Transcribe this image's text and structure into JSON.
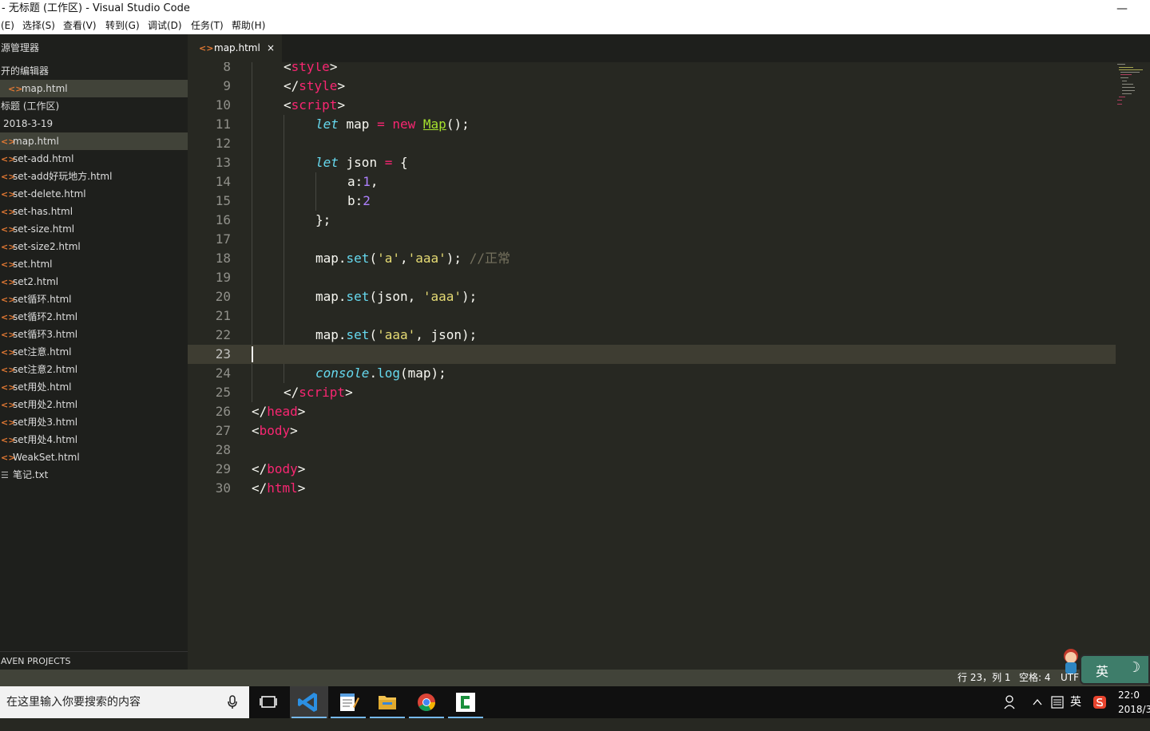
{
  "window": {
    "title": "- 无标题 (工作区) - Visual Studio Code",
    "minimize": "—"
  },
  "menu": [
    "(E)",
    "选择(S)",
    "查看(V)",
    "转到(G)",
    "调试(D)",
    "任务(T)",
    "帮助(H)"
  ],
  "sidebar": {
    "header": "源管理器",
    "open_editors_label": "开的编辑器",
    "open_editor_file": "map.html",
    "workspace_label": "标题 (工作区)",
    "folder_label": "2018-3-19",
    "files": [
      {
        "name": "map.html",
        "type": "html",
        "selected": true
      },
      {
        "name": "set-add.html",
        "type": "html"
      },
      {
        "name": "set-add好玩地方.html",
        "type": "html"
      },
      {
        "name": "set-delete.html",
        "type": "html"
      },
      {
        "name": "set-has.html",
        "type": "html"
      },
      {
        "name": "set-size.html",
        "type": "html"
      },
      {
        "name": "set-size2.html",
        "type": "html"
      },
      {
        "name": "set.html",
        "type": "html"
      },
      {
        "name": "set2.html",
        "type": "html"
      },
      {
        "name": "set循环.html",
        "type": "html"
      },
      {
        "name": "set循环2.html",
        "type": "html"
      },
      {
        "name": "set循环3.html",
        "type": "html"
      },
      {
        "name": "set注意.html",
        "type": "html"
      },
      {
        "name": "set注意2.html",
        "type": "html"
      },
      {
        "name": "set用处.html",
        "type": "html"
      },
      {
        "name": "set用处2.html",
        "type": "html"
      },
      {
        "name": "set用处3.html",
        "type": "html"
      },
      {
        "name": "set用处4.html",
        "type": "html"
      },
      {
        "name": "WeakSet.html",
        "type": "html"
      },
      {
        "name": "笔记.txt",
        "type": "txt"
      }
    ],
    "maven_label": "AVEN PROJECTS"
  },
  "tab": {
    "label": "map.html",
    "close": "×"
  },
  "editor": {
    "current_line": 23,
    "lines": [
      {
        "n": "8",
        "indent": 1,
        "tokens": [
          [
            "p",
            "<"
          ],
          [
            "tag",
            "style"
          ],
          [
            "p",
            ">"
          ]
        ]
      },
      {
        "n": "9",
        "indent": 1,
        "tokens": [
          [
            "p",
            "</"
          ],
          [
            "tag",
            "style"
          ],
          [
            "p",
            ">"
          ]
        ]
      },
      {
        "n": "10",
        "indent": 1,
        "tokens": [
          [
            "p",
            "<"
          ],
          [
            "tag",
            "script"
          ],
          [
            "p",
            ">"
          ]
        ]
      },
      {
        "n": "11",
        "indent": 2,
        "tokens": [
          [
            "st",
            "let"
          ],
          [
            "p",
            " map "
          ],
          [
            "kw",
            "="
          ],
          [
            "p",
            " "
          ],
          [
            "kw",
            "new"
          ],
          [
            "p",
            " "
          ],
          [
            "fn",
            "Map"
          ],
          [
            "p",
            "();"
          ]
        ]
      },
      {
        "n": "12",
        "indent": 2,
        "tokens": []
      },
      {
        "n": "13",
        "indent": 2,
        "tokens": [
          [
            "st",
            "let"
          ],
          [
            "p",
            " json "
          ],
          [
            "kw",
            "="
          ],
          [
            "p",
            " {"
          ]
        ]
      },
      {
        "n": "14",
        "indent": 3,
        "tokens": [
          [
            "p",
            "a:"
          ],
          [
            "num",
            "1"
          ],
          [
            "p",
            ","
          ]
        ]
      },
      {
        "n": "15",
        "indent": 3,
        "tokens": [
          [
            "p",
            "b:"
          ],
          [
            "num",
            "2"
          ]
        ]
      },
      {
        "n": "16",
        "indent": 2,
        "tokens": [
          [
            "p",
            "};"
          ]
        ]
      },
      {
        "n": "17",
        "indent": 2,
        "tokens": []
      },
      {
        "n": "18",
        "indent": 2,
        "tokens": [
          [
            "p",
            "map."
          ],
          [
            "fc",
            "set"
          ],
          [
            "p",
            "("
          ],
          [
            "str",
            "'a'"
          ],
          [
            "p",
            ","
          ],
          [
            "str",
            "'aaa'"
          ],
          [
            "p",
            "); "
          ],
          [
            "cm",
            "//正常"
          ]
        ]
      },
      {
        "n": "19",
        "indent": 2,
        "tokens": []
      },
      {
        "n": "20",
        "indent": 2,
        "tokens": [
          [
            "p",
            "map."
          ],
          [
            "fc",
            "set"
          ],
          [
            "p",
            "(json, "
          ],
          [
            "str",
            "'aaa'"
          ],
          [
            "p",
            ");"
          ]
        ]
      },
      {
        "n": "21",
        "indent": 2,
        "tokens": []
      },
      {
        "n": "22",
        "indent": 2,
        "tokens": [
          [
            "p",
            "map."
          ],
          [
            "fc",
            "set"
          ],
          [
            "p",
            "("
          ],
          [
            "str",
            "'aaa'"
          ],
          [
            "p",
            ", json);"
          ]
        ]
      },
      {
        "n": "23",
        "indent": 0,
        "tokens": []
      },
      {
        "n": "24",
        "indent": 2,
        "tokens": [
          [
            "st",
            "console"
          ],
          [
            "p",
            "."
          ],
          [
            "fc",
            "log"
          ],
          [
            "p",
            "(map);"
          ]
        ]
      },
      {
        "n": "25",
        "indent": 1,
        "tokens": [
          [
            "p",
            "</"
          ],
          [
            "tag",
            "script"
          ],
          [
            "p",
            ">"
          ]
        ]
      },
      {
        "n": "26",
        "indent": 0,
        "tokens": [
          [
            "p",
            "</"
          ],
          [
            "tag",
            "head"
          ],
          [
            "p",
            ">"
          ]
        ]
      },
      {
        "n": "27",
        "indent": 0,
        "tokens": [
          [
            "p",
            "<"
          ],
          [
            "tag",
            "body"
          ],
          [
            "p",
            ">"
          ]
        ]
      },
      {
        "n": "28",
        "indent": 0,
        "tokens": []
      },
      {
        "n": "29",
        "indent": 0,
        "tokens": [
          [
            "p",
            "</"
          ],
          [
            "tag",
            "body"
          ],
          [
            "p",
            ">"
          ]
        ]
      },
      {
        "n": "30",
        "indent": 0,
        "tokens": [
          [
            "p",
            "</"
          ],
          [
            "tag",
            "html"
          ],
          [
            "p",
            ">"
          ]
        ]
      }
    ]
  },
  "statusbar": {
    "position": "行 23，列 1",
    "indent": "空格: 4",
    "encoding": "UTF"
  },
  "ime": {
    "char": "英",
    "moon": "☽"
  },
  "taskbar": {
    "search_placeholder": "在这里输入你要搜索的内容",
    "apps": [
      "task-view",
      "vscode",
      "notepad",
      "file-explorer",
      "chrome",
      "camtasia"
    ],
    "tray_lang": "英",
    "clock_time": "22:0",
    "clock_date": "2018/3"
  }
}
